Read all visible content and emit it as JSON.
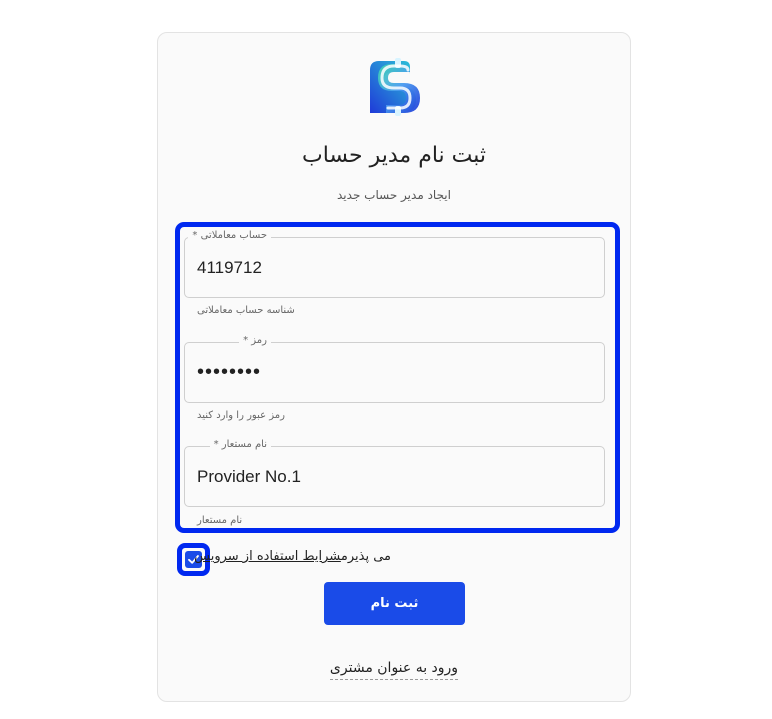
{
  "header": {
    "title": "ثبت نام مدیر حساب",
    "subtitle": "ایجاد مدیر حساب جدید"
  },
  "form": {
    "account": {
      "label": "حساب معاملاتی *",
      "value": "4119712",
      "helper": "شناسه حساب معاملاتی"
    },
    "password": {
      "label": "رمز *",
      "value": "••••••••",
      "helper": "رمز عبور را وارد کنید"
    },
    "nickname": {
      "label": "نام مستعار *",
      "value": "Provider No.1",
      "helper": "نام مستعار"
    }
  },
  "terms": {
    "checked": true,
    "prefix": "می پذیرم",
    "link": "شرایط استفاده از سرویس"
  },
  "actions": {
    "submit_label": "ثبت نام",
    "client_login_label": "ورود به عنوان مشتری"
  },
  "colors": {
    "primary": "#1a4be8",
    "highlight": "#0028f0"
  }
}
